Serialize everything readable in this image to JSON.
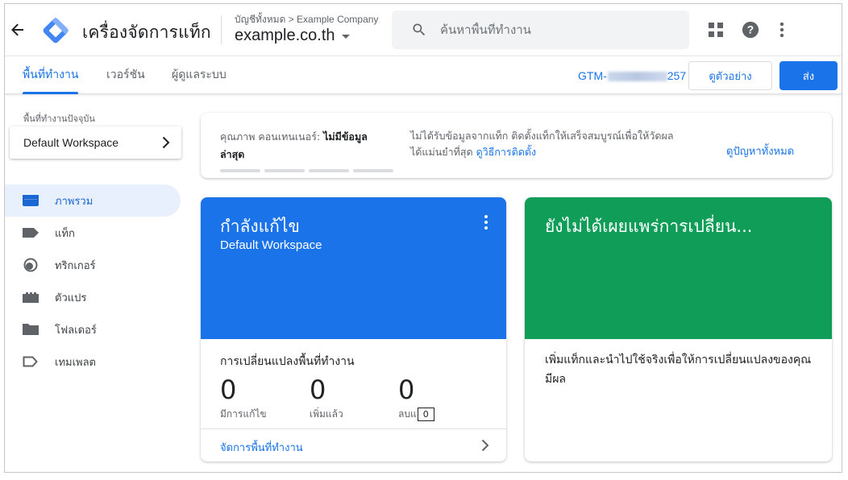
{
  "header": {
    "app_title": "เครื่องจัดการแท็ก",
    "account_path": "บัญชีทั้งหมด > Example Company",
    "container_name": "example.co.th",
    "search_placeholder": "ค้นหาพื้นที่ทำงาน"
  },
  "nav": {
    "tabs": [
      {
        "label": "พื้นที่ทำงาน",
        "active": true
      },
      {
        "label": "เวอร์ชัน",
        "active": false
      },
      {
        "label": "ผู้ดูแลระบบ",
        "active": false
      }
    ],
    "container_id": "GTM-",
    "container_id_tail": "257",
    "preview_label": "ดูตัวอย่าง",
    "submit_label": "ส่ง"
  },
  "sidebar": {
    "current_workspace_label": "พื้นที่ทำงานปัจจุบัน",
    "workspace_name": "Default Workspace",
    "items": [
      {
        "label": "ภาพรวม",
        "icon": "overview-icon",
        "active": true
      },
      {
        "label": "แท็ก",
        "icon": "tag-icon",
        "active": false
      },
      {
        "label": "ทริกเกอร์",
        "icon": "trigger-icon",
        "active": false
      },
      {
        "label": "ตัวแปร",
        "icon": "variable-icon",
        "active": false
      },
      {
        "label": "โฟลเดอร์",
        "icon": "folder-icon",
        "active": false
      },
      {
        "label": "เทมเพลต",
        "icon": "template-icon",
        "active": false
      }
    ]
  },
  "quality": {
    "title_prefix": "คุณภาพ คอนเทนเนอร์: ",
    "title_value": "ไม่มีข้อมูลล่าสุด",
    "message": "ไม่ได้รับข้อมูลจากแท็ก ติดตั้งแท็กให้เสร็จสมบูรณ์เพื่อให้วัดผลได้แม่นยำที่สุด ",
    "howto_link": "ดูวิธีการติดตั้ง",
    "view_all_link": "ดูปัญหาทั้งหมด"
  },
  "editing": {
    "heading": "กำลังแก้ไข",
    "workspace": "Default Workspace",
    "changes_title": "การเปลี่ยนแปลงพื้นที่ทำงาน",
    "stats": [
      {
        "value": "0",
        "label": "มีการแก้ไข"
      },
      {
        "value": "0",
        "label": "เพิ่มแล้ว"
      },
      {
        "value": "0",
        "label": "ลบแ",
        "tooltip": "0"
      }
    ],
    "manage_link": "จัดการพื้นที่ทำงาน"
  },
  "unpublished": {
    "heading": "ยังไม่ได้เผยแพร่การเปลี่ยน...",
    "body": "เพิ่มแท็กและนำไปใช้จริงเพื่อให้การเปลี่ยนแปลงของคุณมีผล"
  },
  "colors": {
    "accent": "#1a73e8",
    "editing_bg": "#1a73e8",
    "unpublished_bg": "#0f9d58"
  }
}
